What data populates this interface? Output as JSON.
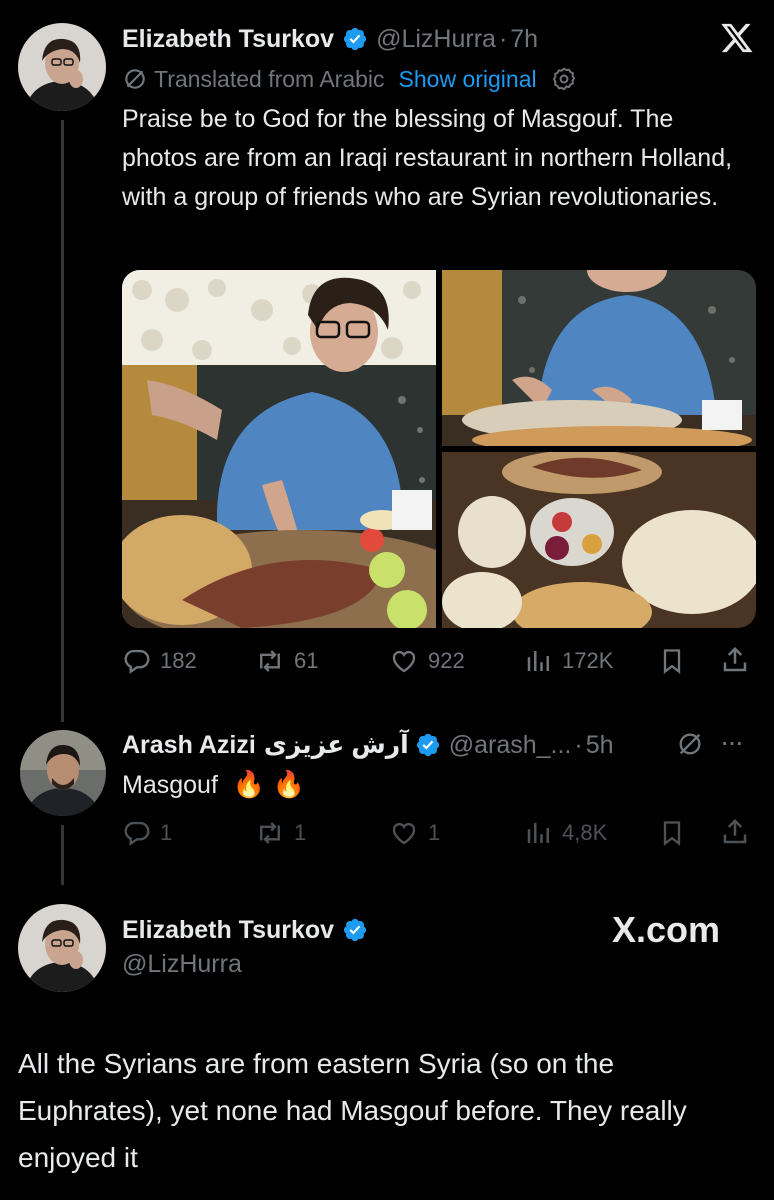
{
  "tweet1": {
    "display_name": "Elizabeth Tsurkov",
    "handle": "@LizHurra",
    "sep": "·",
    "time": "7h",
    "translated_label": "Translated from Arabic",
    "show_original": "Show original",
    "text": "Praise be to God for the blessing of Masgouf. The photos are from an Iraqi restaurant in northern Holland, with a group of friends who are Syrian revolutionaries.",
    "replies": "182",
    "reposts": "61",
    "likes": "922",
    "views": "172K"
  },
  "tweet2": {
    "display_name": "Arash Azizi",
    "display_name_ar": "آرش عزیزی",
    "handle": "@arash_...",
    "sep": "·",
    "time": "5h",
    "more": "···",
    "text": "Masgouf",
    "emoji": "🔥 🔥",
    "replies": "1",
    "reposts": "1",
    "likes": "1",
    "views": "4,8K"
  },
  "tweet3": {
    "display_name": "Elizabeth Tsurkov",
    "handle": "@LizHurra",
    "brand": "X.com",
    "text": "All the Syrians are from eastern Syria (so on the Euphrates), yet none had Masgouf before. They really enjoyed it"
  },
  "colors": {
    "background": "#000000",
    "text": "#e7e9ea",
    "muted": "#71767b",
    "link": "#1d9bf0",
    "verified": "#1d9bf0"
  },
  "icons": [
    "x-logo-icon",
    "verified-icon",
    "reply-icon",
    "repost-icon",
    "like-icon",
    "views-icon",
    "bookmark-icon",
    "share-icon",
    "translate-icon",
    "settings-icon",
    "grok-icon",
    "more-icon"
  ]
}
